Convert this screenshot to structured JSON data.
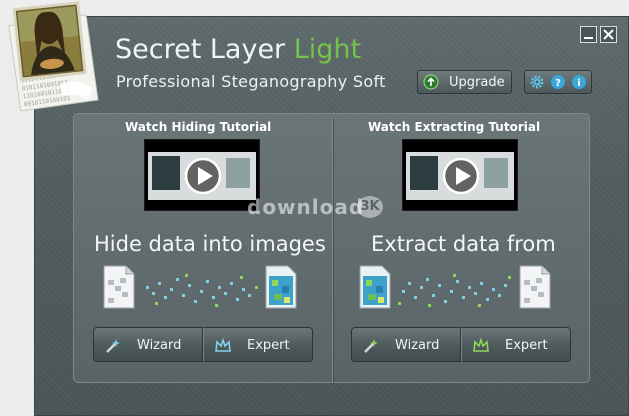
{
  "app": {
    "title_main": "Secret Layer ",
    "title_accent": "Light",
    "subtitle": "Professional Steganography Soft"
  },
  "toolbar": {
    "upgrade_label": "Upgrade",
    "icons": [
      "settings-gear-icon",
      "help-icon",
      "info-icon"
    ]
  },
  "hiding": {
    "tutorial_title": "Watch Hiding Tutorial",
    "heading": "Hide data into images",
    "wizard_label": "Wizard",
    "expert_label": "Expert"
  },
  "extracting": {
    "tutorial_title": "Watch Extracting Tutorial",
    "heading": "Extract data from",
    "wizard_label": "Wizard",
    "expert_label": "Expert"
  },
  "watermark": {
    "text": "download",
    "badge": "3K"
  },
  "colors": {
    "accent_green": "#74c34a",
    "window_bg": "#525d5f",
    "panel_bg": "#626d6f"
  }
}
